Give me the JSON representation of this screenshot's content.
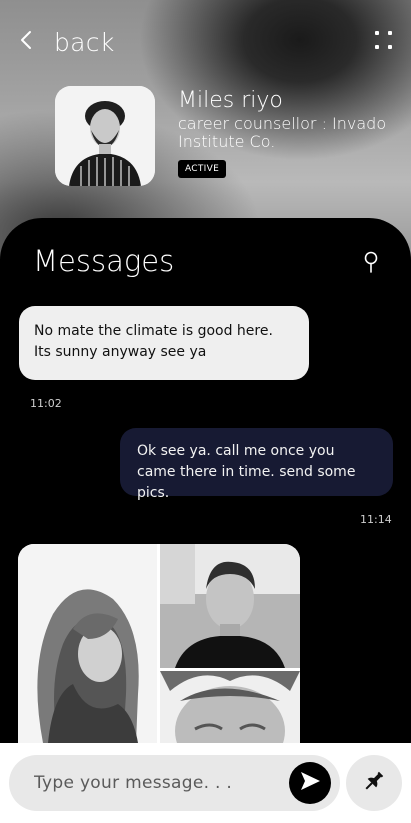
{
  "header": {
    "back_label": "back"
  },
  "profile": {
    "name": "Miles riyo",
    "role": "career counsellor : Invado Institute Co.",
    "status": "ACTIVE"
  },
  "messages": {
    "title": "Messages",
    "items": [
      {
        "direction": "incoming",
        "text": "No mate the climate is good here. Its sunny anyway see ya",
        "time": "11:02"
      },
      {
        "direction": "outgoing",
        "text": "Ok see ya. call me once you came there in time. send some pics.",
        "time": "11:14"
      }
    ]
  },
  "composer": {
    "placeholder": "Type your message. . ."
  },
  "icons": {
    "back": "chevron-left-icon",
    "menu": "grid-dots-icon",
    "search": "search-pin-icon",
    "send": "send-icon",
    "attach": "pin-icon"
  },
  "colors": {
    "panel": "#000000",
    "incoming_bubble": "#efefef",
    "outgoing_bubble": "#171a33",
    "input_bg": "#e8e8e8"
  }
}
